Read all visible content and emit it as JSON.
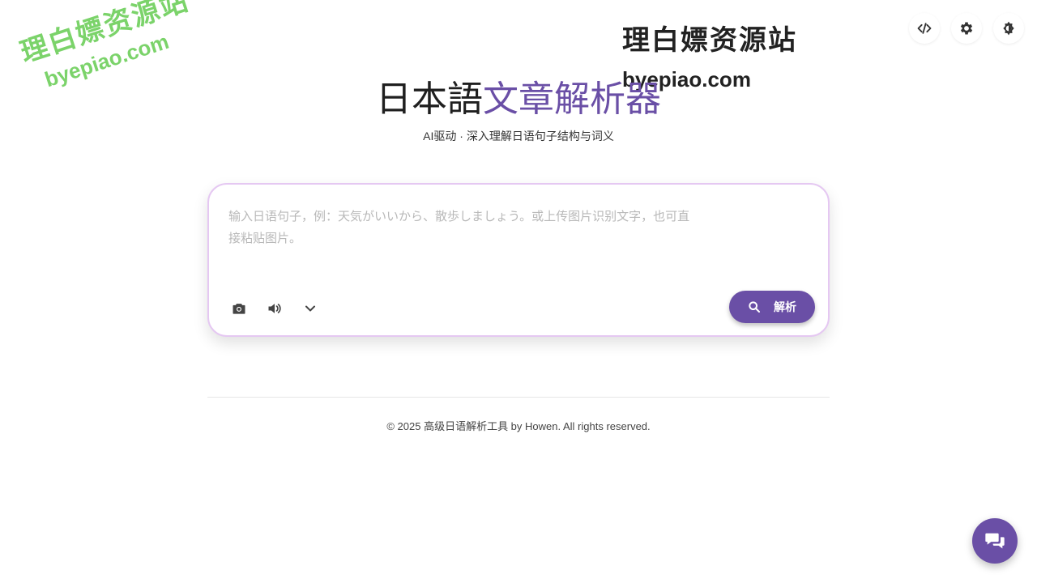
{
  "watermarks": {
    "left": {
      "line1": "理白嫖资源站",
      "line2": "byepiao.com"
    },
    "right": {
      "line1": "理白嫖资源站",
      "line2": "byepiao.com"
    }
  },
  "top_actions": [
    {
      "icon": "code-icon"
    },
    {
      "icon": "gear-icon"
    },
    {
      "icon": "theme-toggle-icon"
    }
  ],
  "header": {
    "title_part1": "日本語",
    "title_part2": "文章解析器",
    "subtitle": "AI驱动 · 深入理解日语句子结构与词义"
  },
  "input": {
    "placeholder": "输入日语句子，例：天気がいいから、散歩しましょう。或上传图片识别文字，也可直接粘贴图片。",
    "value": ""
  },
  "tools": [
    {
      "icon": "camera-icon"
    },
    {
      "icon": "volume-icon"
    },
    {
      "icon": "chevron-down-icon"
    }
  ],
  "parse_button": {
    "label": "解析",
    "icon": "search-icon"
  },
  "footer": {
    "text": "© 2025 高级日语解析工具 by Howen. All rights reserved."
  },
  "colors": {
    "accent": "#6a4fa6",
    "card_border": "#e5c8f2",
    "watermark_green": "#7bd36a"
  },
  "chat_fab": {
    "icon": "chat-icon"
  }
}
